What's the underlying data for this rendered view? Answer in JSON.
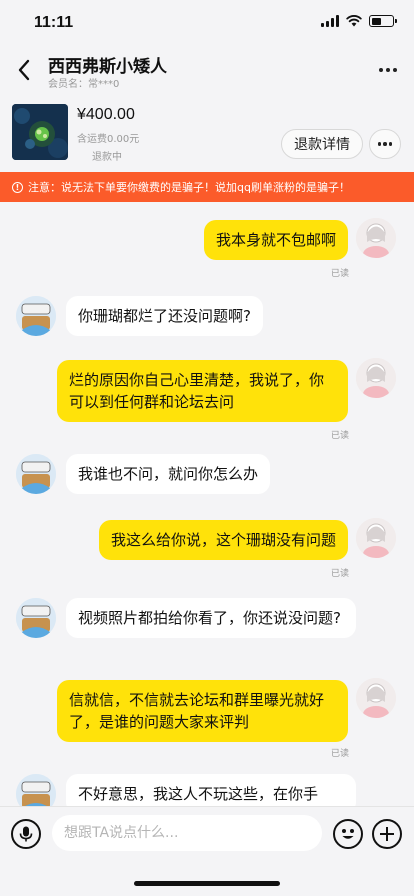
{
  "status_bar": {
    "time": "11:11"
  },
  "header": {
    "title": "西西弗斯小矮人",
    "subtitle": "会员名：常***0"
  },
  "order": {
    "price": "¥400.00",
    "shipping": "含运费0.00元",
    "status": "退款中",
    "refund_button": "退款详情"
  },
  "warning": {
    "text": "注意：说无法下单要你缴费的是骗子！说加qq刷单涨粉的是骗子！"
  },
  "messages": [
    {
      "from": "me",
      "text": "我本身就不包邮啊",
      "read": "已读"
    },
    {
      "from": "other",
      "text": "你珊瑚都烂了还没问题啊?"
    },
    {
      "from": "me",
      "text": "烂的原因你自己心里清楚，我说了，你可以到任何群和论坛去问",
      "read": "已读"
    },
    {
      "from": "other",
      "text": "我谁也不问，就问你怎么办"
    },
    {
      "from": "me",
      "text": "我这么给你说，这个珊瑚没有问题",
      "read": "已读"
    },
    {
      "from": "other",
      "text": "视频照片都拍给你看了，你还说没问题?"
    },
    {
      "from": "me",
      "text": "信就信，不信就去论坛和群里曝光就好了，是谁的问题大家来评判",
      "read": "已读"
    },
    {
      "from": "other",
      "text": "不好意思，我这人不玩这些，在你手"
    }
  ],
  "input": {
    "placeholder": "想跟TA说点什么..."
  },
  "colors": {
    "me_bubble": "#ffe20a",
    "other_bubble": "#ffffff",
    "warning_bg": "#fb5b2a",
    "page_bg": "#f4f4f6"
  }
}
